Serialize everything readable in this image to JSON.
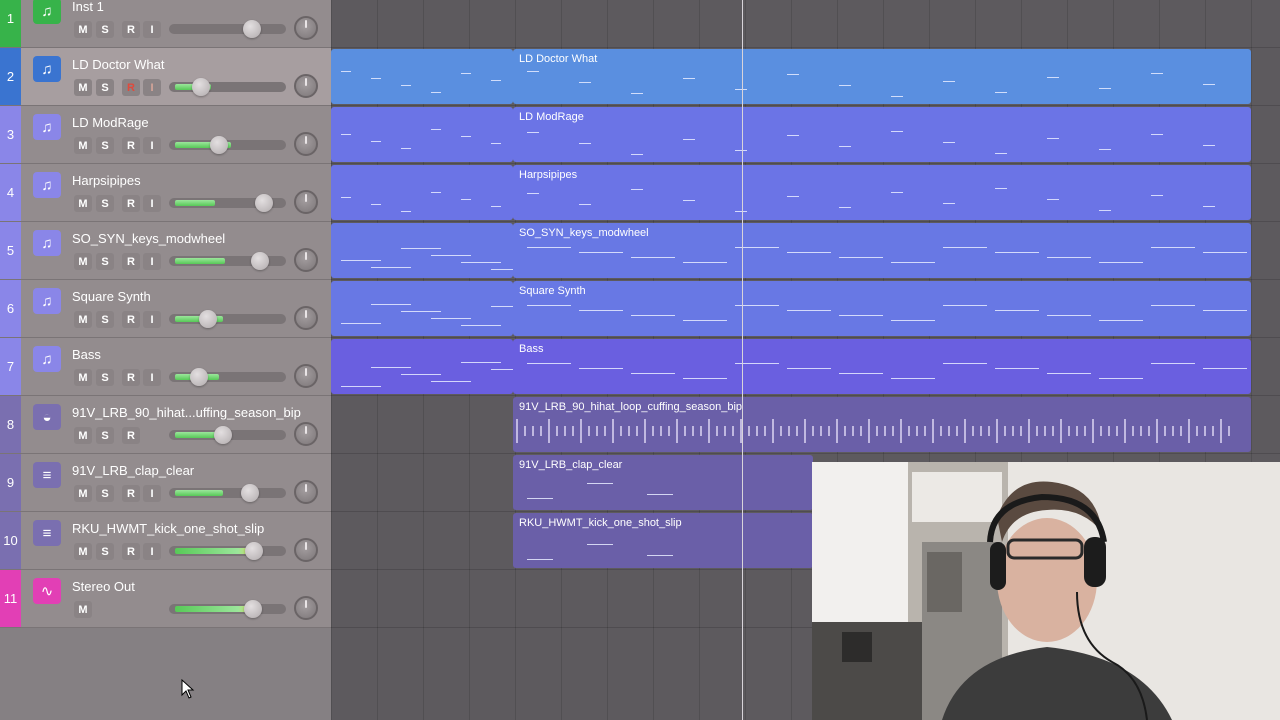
{
  "tracks": [
    {
      "num": "1",
      "name": "Inst 1",
      "buttons": [
        "M",
        "S",
        "R",
        "I"
      ],
      "color": "#37b34a",
      "icon": "synth-icon"
    },
    {
      "num": "2",
      "name": "LD Doctor What",
      "buttons": [
        "M",
        "S",
        "R",
        "I"
      ],
      "color": "#3a74d0",
      "icon": "midi-note-icon",
      "selected": true
    },
    {
      "num": "3",
      "name": "LD ModRage",
      "buttons": [
        "M",
        "S",
        "R",
        "I"
      ],
      "color": "#8a86e8",
      "icon": "midi-note-icon"
    },
    {
      "num": "4",
      "name": "Harpsipipes",
      "buttons": [
        "M",
        "S",
        "R",
        "I"
      ],
      "color": "#8a86e8",
      "icon": "midi-note-icon"
    },
    {
      "num": "5",
      "name": "SO_SYN_keys_modwheel",
      "buttons": [
        "M",
        "S",
        "R",
        "I"
      ],
      "color": "#8a86e8",
      "icon": "midi-note-icon"
    },
    {
      "num": "6",
      "name": "Square Synth",
      "buttons": [
        "M",
        "S",
        "R",
        "I"
      ],
      "color": "#8a86e8",
      "icon": "midi-note-icon"
    },
    {
      "num": "7",
      "name": "Bass",
      "buttons": [
        "M",
        "S",
        "R",
        "I"
      ],
      "color": "#8a86e8",
      "icon": "midi-note-icon"
    },
    {
      "num": "8",
      "name": "91V_LRB_90_hihat...uffing_season_bip",
      "buttons": [
        "M",
        "S",
        "R"
      ],
      "color": "#7a6fb0",
      "icon": "hihat-icon"
    },
    {
      "num": "9",
      "name": "91V_LRB_clap_clear",
      "buttons": [
        "M",
        "S",
        "R",
        "I"
      ],
      "color": "#7a6fb0",
      "icon": "drum-machine-icon"
    },
    {
      "num": "10",
      "name": "RKU_HWMT_kick_one_shot_slip",
      "buttons": [
        "M",
        "S",
        "R",
        "I"
      ],
      "color": "#7a6fb0",
      "icon": "drum-machine-icon"
    },
    {
      "num": "11",
      "name": "Stereo Out",
      "buttons": [
        "M"
      ],
      "color": "#e23fb5",
      "icon": "waveform-icon"
    }
  ],
  "regions": [
    {
      "name": "LD Doctor What"
    },
    {
      "name": "LD ModRage"
    },
    {
      "name": "Harpsipipes"
    },
    {
      "name": "SO_SYN_keys_modwheel"
    },
    {
      "name": "Square Synth"
    },
    {
      "name": "Bass"
    },
    {
      "name": "91V_LRB_90_hihat_loop_cuffing_season_bip"
    },
    {
      "name": "91V_LRB_clap_clear"
    },
    {
      "name": "RKU_HWMT_kick_one_shot_slip"
    }
  ],
  "colors": {
    "midi_region_blue": "#5a8fe0",
    "midi_region_violet": "#6b74e6",
    "audio_region": "#6a5fa8",
    "meter_green": "#57c957"
  }
}
